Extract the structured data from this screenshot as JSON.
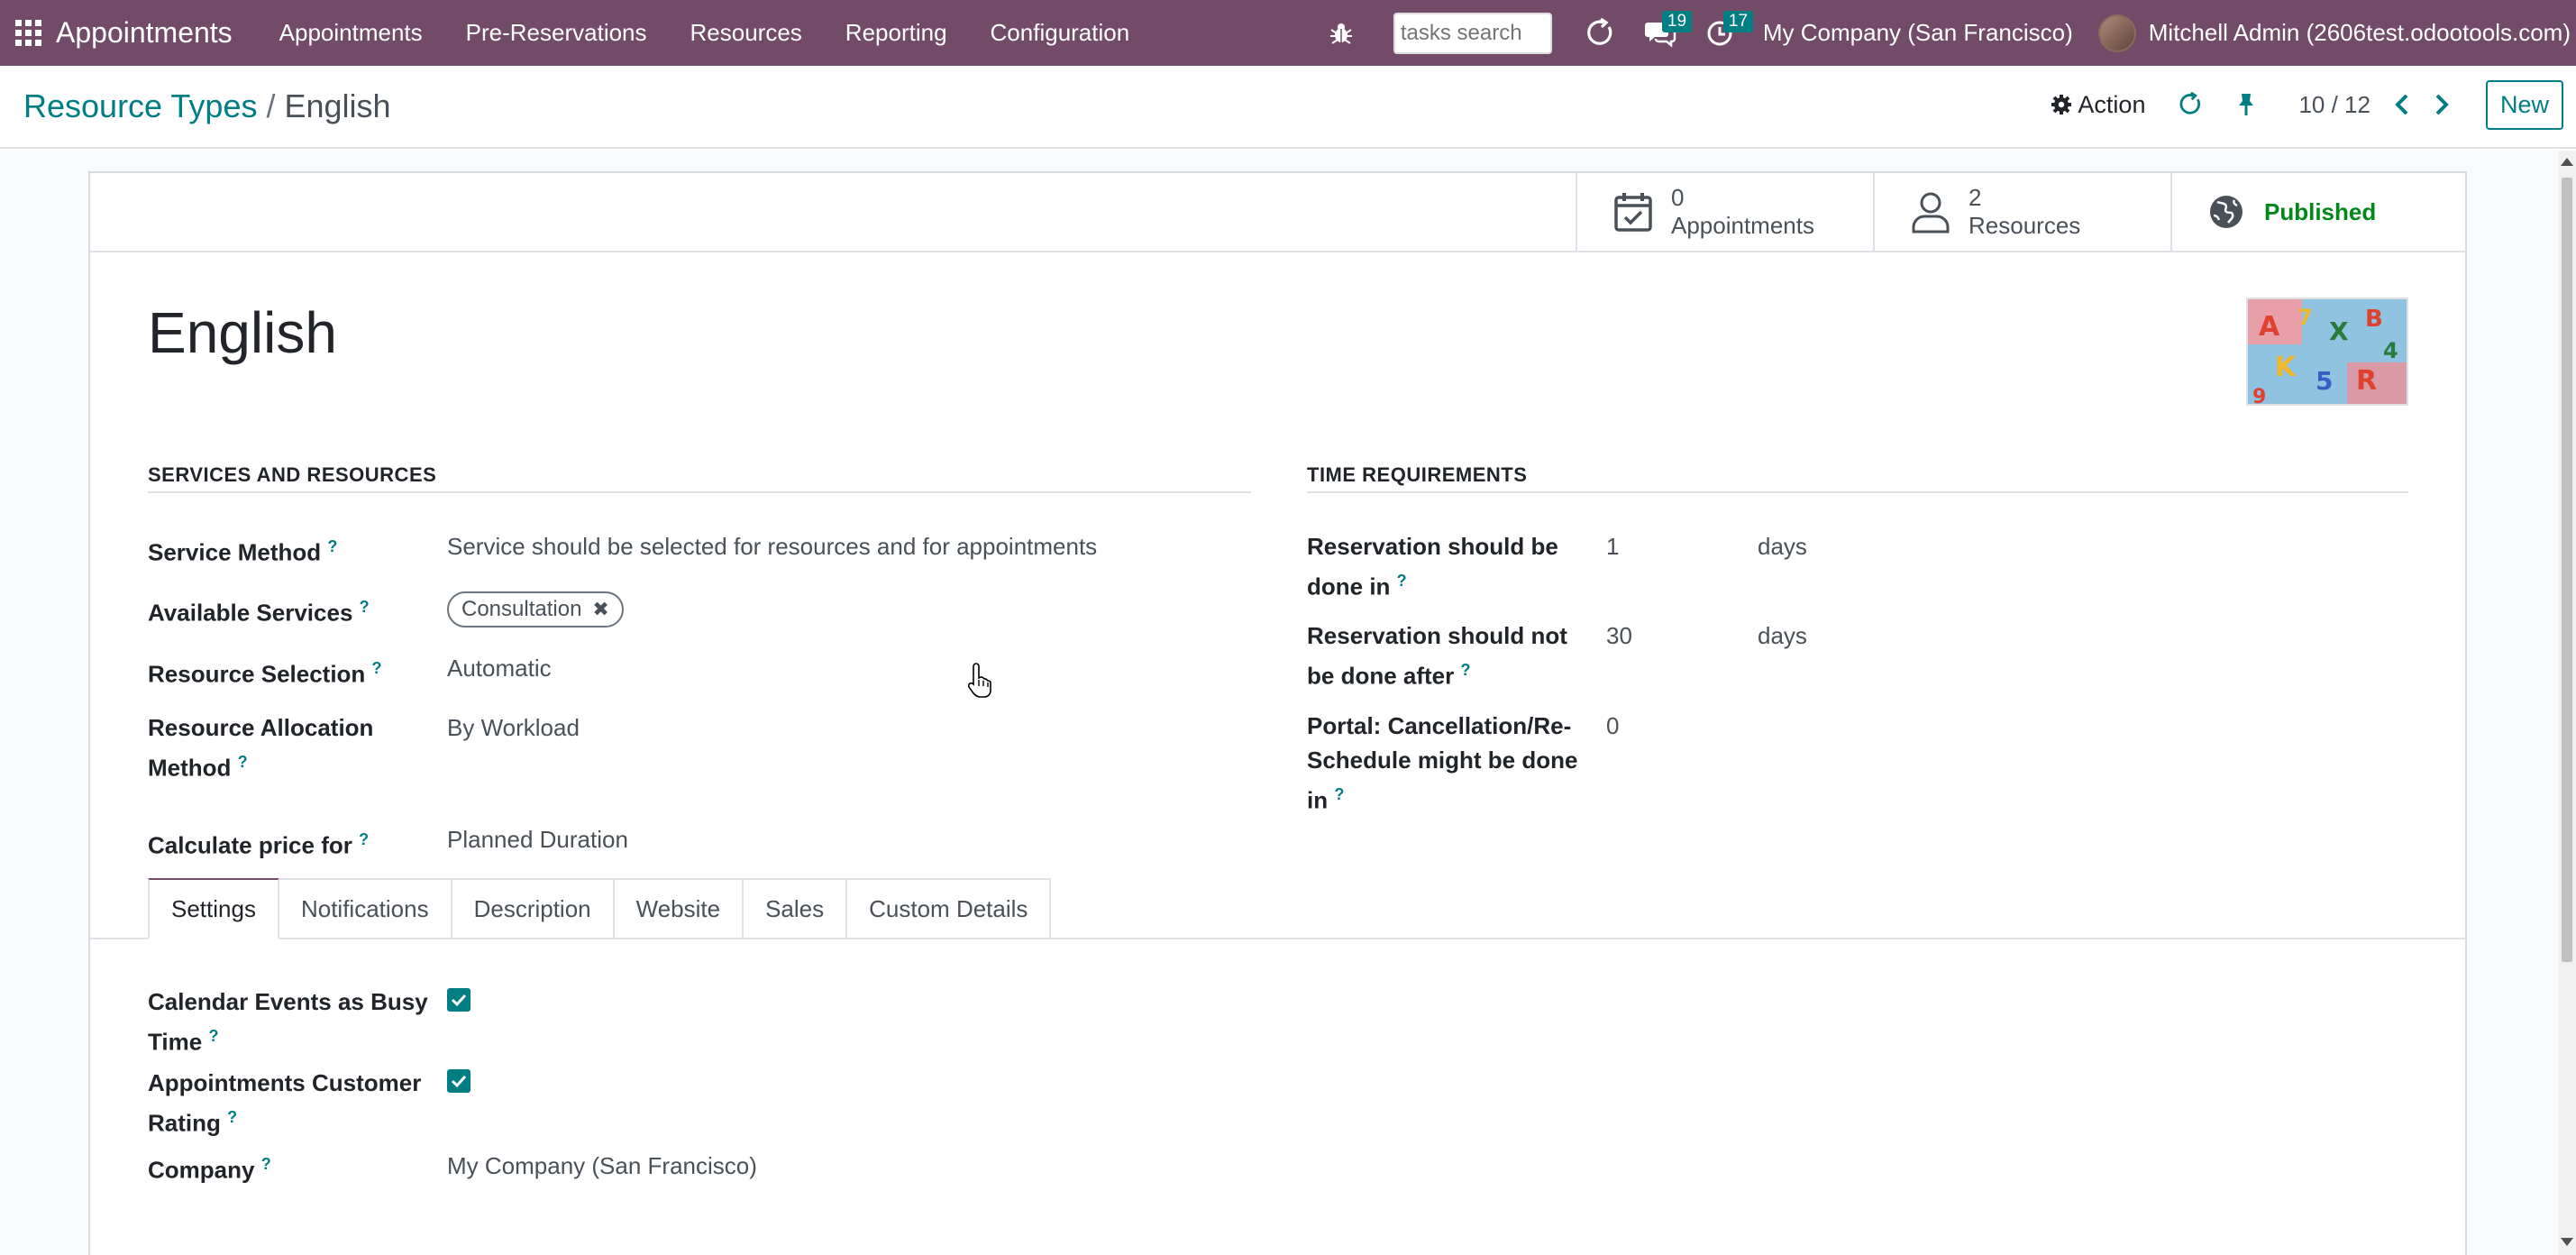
{
  "navbar": {
    "brand": "Appointments",
    "menu": [
      "Appointments",
      "Pre-Reservations",
      "Resources",
      "Reporting",
      "Configuration"
    ],
    "search_placeholder": "tasks search",
    "messages_count": "19",
    "activities_count": "17",
    "company": "My Company (San Francisco)",
    "user": "Mitchell Admin (2606test.odootools.com)"
  },
  "control": {
    "breadcrumb_parent": "Resource Types",
    "breadcrumb_separator": "/",
    "breadcrumb_current": "English",
    "action_label": "Action",
    "pager": "10 / 12",
    "new_label": "New"
  },
  "stats": {
    "appointments_count": "0",
    "appointments_label": "Appointments",
    "resources_count": "2",
    "resources_label": "Resources",
    "published_label": "Published"
  },
  "record": {
    "title": "English"
  },
  "services": {
    "section_title": "SERVICES AND RESOURCES",
    "service_method_label": "Service Method",
    "service_method_value": "Service should be selected for resources and for appointments",
    "available_services_label": "Available Services",
    "available_services_tag": "Consultation",
    "resource_selection_label": "Resource Selection",
    "resource_selection_value": "Automatic",
    "allocation_label_1": "Resource Allocation",
    "allocation_label_2": "Method",
    "allocation_value": "By Workload",
    "price_label": "Calculate price for",
    "price_value": "Planned Duration"
  },
  "time": {
    "section_title": "TIME REQUIREMENTS",
    "done_in_label_1": "Reservation should be",
    "done_in_label_2": "done in",
    "done_in_value": "1",
    "done_in_unit": "days",
    "not_after_label_1": "Reservation should not",
    "not_after_label_2": "be done after",
    "not_after_value": "30",
    "not_after_unit": "days",
    "portal_label_1": "Portal: Cancellation/Re-",
    "portal_label_2": "Schedule might be done",
    "portal_label_3": "in",
    "portal_value": "0"
  },
  "tabs": [
    "Settings",
    "Notifications",
    "Description",
    "Website",
    "Sales",
    "Custom Details"
  ],
  "settings": {
    "busy_label_1": "Calendar Events as Busy",
    "busy_label_2": "Time",
    "busy_checked": true,
    "rating_label_1": "Appointments Customer",
    "rating_label_2": "Rating",
    "rating_checked": true,
    "company_label": "Company",
    "company_value": "My Company (San Francisco)"
  },
  "help_mark": "?",
  "colors": {
    "navbar": "#714b67",
    "accent": "#017e84",
    "published": "#008818"
  }
}
